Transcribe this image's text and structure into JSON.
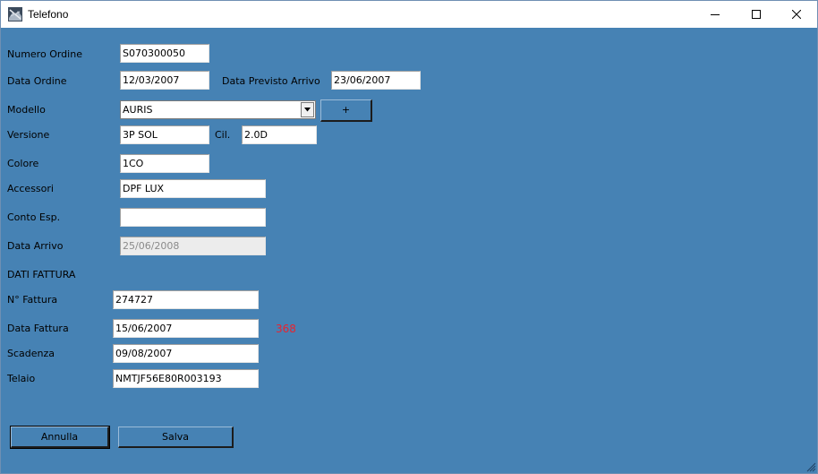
{
  "window": {
    "title": "Telefono"
  },
  "form": {
    "numero_ordine": {
      "label": "Numero Ordine",
      "value": "S070300050"
    },
    "data_ordine": {
      "label": "Data Ordine",
      "value": "12/03/2007"
    },
    "data_previsto_arrivo": {
      "label": "Data Previsto Arrivo",
      "value": "23/06/2007"
    },
    "modello": {
      "label": "Modello",
      "value": "AURIS",
      "add_button": "+"
    },
    "versione": {
      "label": "Versione",
      "value": "3P SOL"
    },
    "cil": {
      "label": "Cil.",
      "value": "2.0D"
    },
    "colore": {
      "label": "Colore",
      "value": "1CO"
    },
    "accessori": {
      "label": "Accessori",
      "value": "DPF LUX"
    },
    "conto_esp": {
      "label": "Conto Esp.",
      "value": ""
    },
    "data_arrivo": {
      "label": "Data Arrivo",
      "value": "25/06/2008"
    },
    "section_fattura": "DATI FATTURA",
    "n_fattura": {
      "label": "N° Fattura",
      "value": "274727"
    },
    "data_fattura": {
      "label": "Data Fattura",
      "value": "15/06/2007",
      "days": "368"
    },
    "scadenza": {
      "label": "Scadenza",
      "value": "09/08/2007"
    },
    "telaio": {
      "label": "Telaio",
      "value": "NMTJF56E80R003193"
    }
  },
  "buttons": {
    "annulla": "Annulla",
    "salva": "Salva"
  },
  "colors": {
    "background": "#4682b4",
    "days_text": "#e8232f"
  },
  "icons": {
    "app": "app-icon",
    "minimize": "minimize-icon",
    "maximize": "maximize-icon",
    "close": "close-icon",
    "dropdown": "chevron-down-icon",
    "resize": "resize-grip-icon"
  }
}
